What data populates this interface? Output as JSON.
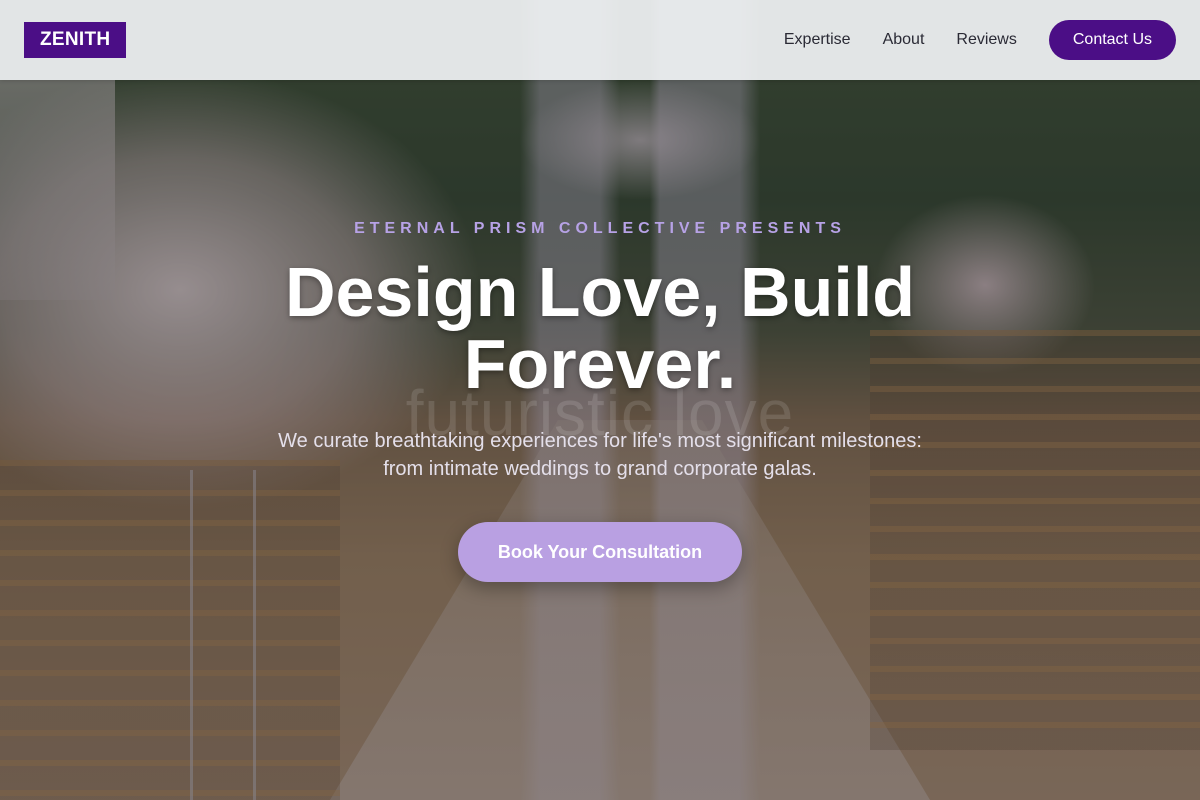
{
  "header": {
    "logo": "ZENITH",
    "nav": {
      "expertise": "Expertise",
      "about": "About",
      "reviews": "Reviews",
      "contact": "Contact Us"
    }
  },
  "hero": {
    "eyebrow": "ETERNAL PRISM COLLECTIVE PRESENTS",
    "headline": "Design Love, Build Forever.",
    "ghost_text": "futuristic love",
    "subtext": "We curate breathtaking experiences for life's most significant milestones: from intimate weddings to grand corporate galas.",
    "cta": "Book Your Consultation"
  },
  "colors": {
    "brand_purple": "#4b0e86",
    "accent_lavender": "#b9a0e2",
    "eyebrow_lavender": "#b7a2e6"
  }
}
